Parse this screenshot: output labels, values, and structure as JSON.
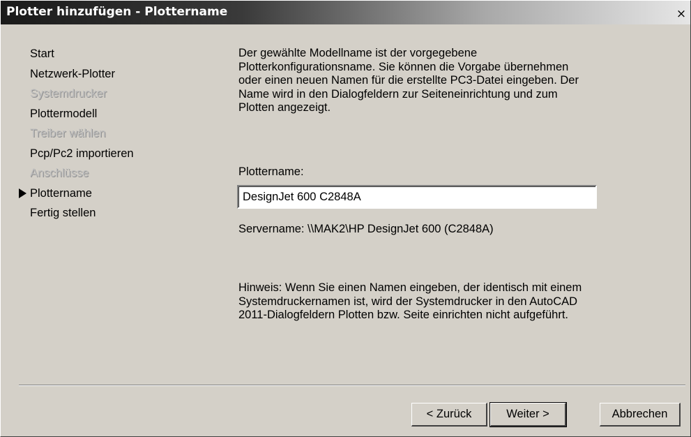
{
  "window": {
    "title": "Plotter hinzufügen - Plottername",
    "close_label": "×"
  },
  "steps": [
    {
      "label": "Start",
      "state": "enabled"
    },
    {
      "label": "Netzwerk-Plotter",
      "state": "enabled"
    },
    {
      "label": "Systemdrucker",
      "state": "disabled"
    },
    {
      "label": "Plottermodell",
      "state": "enabled"
    },
    {
      "label": "Treiber wählen",
      "state": "disabled"
    },
    {
      "label": "Pcp/Pc2 importieren",
      "state": "enabled"
    },
    {
      "label": "Anschlüsse",
      "state": "disabled"
    },
    {
      "label": "Plottername",
      "state": "current"
    },
    {
      "label": "Fertig stellen",
      "state": "enabled"
    }
  ],
  "content": {
    "description": "Der gewählte Modellname ist der vorgegebene Plotterkonfigurationsname. Sie können die Vorgabe übernehmen oder einen neuen Namen für die erstellte PC3-Datei eingeben. Der Name wird in den Dialogfeldern zur Seiteneinrichtung und zum Plotten angezeigt.",
    "field_label": "Plottername:",
    "plotter_name_value": "DesignJet 600 C2848A",
    "server_name": "Servername: \\\\MAK2\\HP DesignJet 600 (C2848A)",
    "hint": "Hinweis: Wenn Sie einen Namen eingeben, der identisch mit einem Systemdruckernamen ist, wird der Systemdrucker in den AutoCAD 2011-Dialogfeldern Plotten bzw. Seite einrichten nicht aufgeführt."
  },
  "buttons": {
    "back": "< Zurück",
    "next": "Weiter >",
    "cancel": "Abbrechen"
  }
}
